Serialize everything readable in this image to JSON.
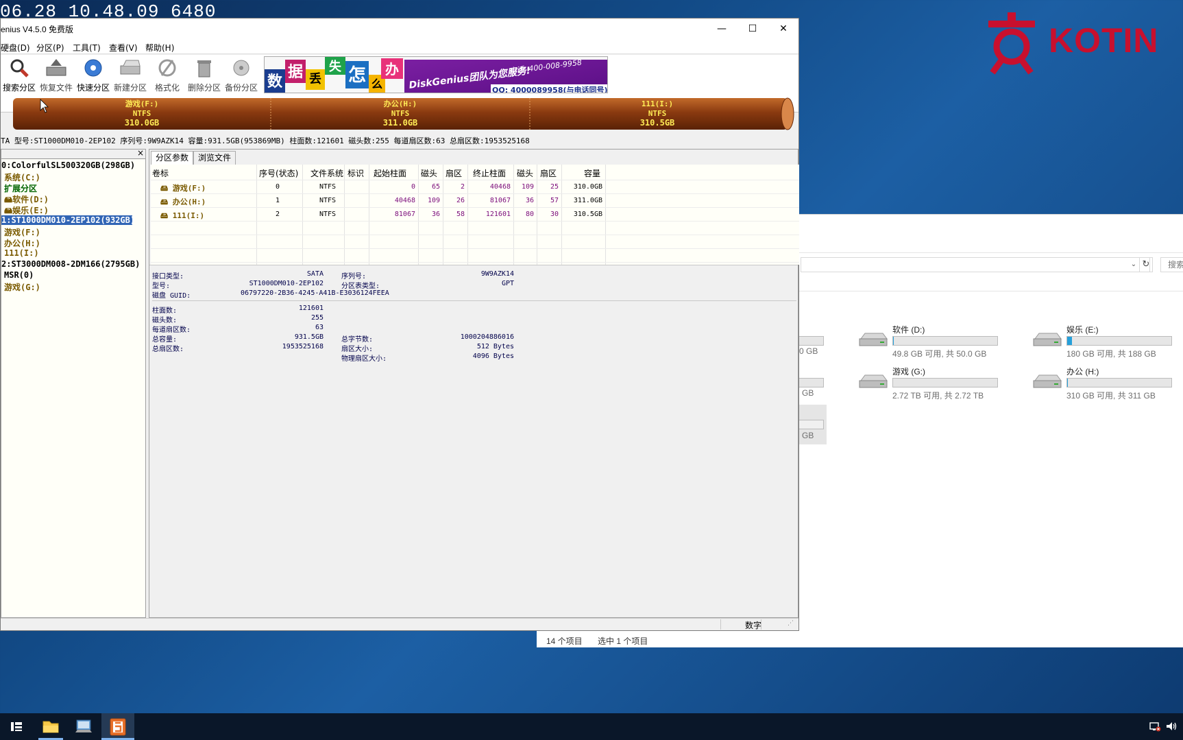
{
  "overlay": {
    "timestamp": "06.28 10.48.09 6480",
    "brand": "KOTIN"
  },
  "dg": {
    "title": "enius V4.5.0 免费版",
    "window_buttons": {
      "minimize": "—",
      "maximize": "☐",
      "close": "✕"
    },
    "menu": [
      "硬盘(D)",
      "分区(P)",
      "工具(T)",
      "查看(V)",
      "帮助(H)"
    ],
    "toolbar": [
      "搜索分区",
      "恢复文件",
      "快速分区",
      "新建分区",
      "格式化",
      "删除分区",
      "备份分区"
    ],
    "banner": {
      "chars": [
        "数",
        "据",
        "丢",
        "失",
        "怎",
        "么",
        "办"
      ],
      "slogan": "DiskGenius团队为您服务!",
      "phone": "电话: 400-008-9958",
      "qq": "QQ: 4000089958(与电话同号)"
    },
    "partitions_bar": [
      {
        "name": "游戏(F:)",
        "fs": "NTFS",
        "size": "310.0GB"
      },
      {
        "name": "办公(H:)",
        "fs": "NTFS",
        "size": "311.0GB"
      },
      {
        "name": "111(I:)",
        "fs": "NTFS",
        "size": "310.5GB"
      }
    ],
    "diskinfo": "TA  型号:ST1000DM010-2EP102  序列号:9W9AZK14  容量:931.5GB(953869MB)  柱面数:121601  磁头数:255  每道扇区数:63  总扇区数:1953525168",
    "tree": [
      {
        "label": "0:ColorfulSL500320GB(298GB)",
        "color": "#000000"
      },
      {
        "label": "系统(C:)",
        "color": "#7a5a00"
      },
      {
        "label": "扩展分区",
        "color": "#006400"
      },
      {
        "label": "软件(D:)",
        "color": "#7a5a00"
      },
      {
        "label": "娱乐(E:)",
        "color": "#7a5a00"
      },
      {
        "label": "1:ST1000DM010-2EP102(932GB)",
        "color": "#ffffff"
      },
      {
        "label": "游戏(F:)",
        "color": "#7a5a00"
      },
      {
        "label": "办公(H:)",
        "color": "#7a5a00"
      },
      {
        "label": "111(I:)",
        "color": "#7a5a00"
      },
      {
        "label": "2:ST3000DM008-2DM166(2795GB)",
        "color": "#000000"
      },
      {
        "label": "MSR(0)",
        "color": "#000000"
      },
      {
        "label": "游戏(G:)",
        "color": "#7a5a00"
      }
    ],
    "tree_close": "×",
    "tabs": [
      "分区参数",
      "浏览文件"
    ],
    "table": {
      "headers": [
        "卷标",
        "序号(状态)",
        "文件系统",
        "标识",
        "起始柱面",
        "磁头",
        "扇区",
        "终止柱面",
        "磁头",
        "扇区",
        "容量"
      ],
      "rows": [
        [
          "游戏(F:)",
          "0",
          "NTFS",
          "",
          "0",
          "65",
          "2",
          "40468",
          "109",
          "25",
          "310.0GB"
        ],
        [
          "办公(H:)",
          "1",
          "NTFS",
          "",
          "40468",
          "109",
          "26",
          "81067",
          "36",
          "57",
          "311.0GB"
        ],
        [
          "111(I:)",
          "2",
          "NTFS",
          "",
          "81067",
          "36",
          "58",
          "121601",
          "80",
          "30",
          "310.5GB"
        ]
      ]
    },
    "details": {
      "iface_label": "接口类型:",
      "iface": "SATA",
      "serial_label": "序列号:",
      "serial": "9W9AZK14",
      "model_label": "型号:",
      "model": "ST1000DM010-2EP102",
      "ptype_label": "分区表类型:",
      "ptype": "GPT",
      "guid_label": "磁盘 GUID:",
      "guid": "06797220-2B36-4245-A41B-E3036124FEEA",
      "cyl_label": "柱面数:",
      "cyl": "121601",
      "heads_label": "磁头数:",
      "heads": "255",
      "spt_label": "每道扇区数:",
      "spt": "63",
      "cap_label": "总容量:",
      "cap": "931.5GB",
      "bytes_label": "总字节数:",
      "bytes": "1000204886016",
      "sectors_label": "总扇区数:",
      "sectors": "1953525168",
      "ssize_label": "扇区大小:",
      "ssize": "512 Bytes",
      "psize_label": "物理扇区大小:",
      "psize": "4096 Bytes"
    },
    "status": "数字"
  },
  "explorer": {
    "search_placeholder": "搜索",
    "partial": [
      "0 GB",
      "GB",
      "GB"
    ],
    "drives": [
      {
        "name": "软件 (D:)",
        "free": "49.8 GB 可用, 共 50.0 GB",
        "used_fraction": 0.004
      },
      {
        "name": "娱乐 (E:)",
        "free": "180 GB 可用, 共 188 GB",
        "used_fraction": 0.043
      },
      {
        "name": "游戏 (G:)",
        "free": "2.72 TB 可用, 共 2.72 TB",
        "used_fraction": 0.0
      },
      {
        "name": "办公 (H:)",
        "free": "310 GB 可用, 共 311 GB",
        "used_fraction": 0.003
      }
    ],
    "status_count": "14 个项目",
    "status_selected": "选中 1 个项目"
  }
}
